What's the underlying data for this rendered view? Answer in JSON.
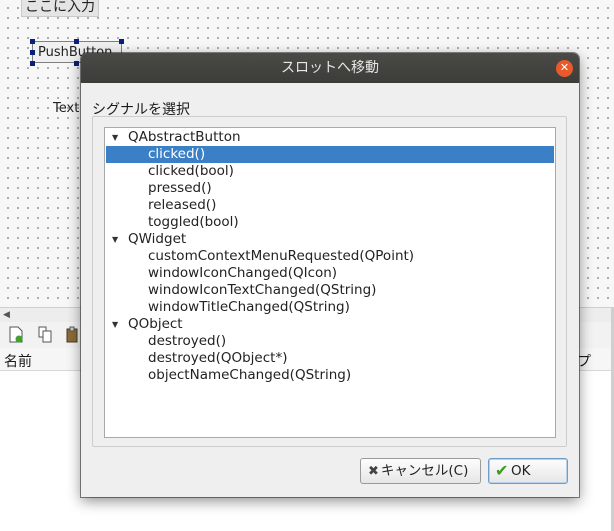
{
  "designer": {
    "menu_entry": "ここに入力",
    "push_button": "PushButton",
    "text_label": "Text",
    "header_name": "名前",
    "header_tail": "プ"
  },
  "dialog": {
    "title": "スロットへ移動",
    "group_title": "シグナルを選択",
    "tree": [
      {
        "label": "QAbstractButton",
        "type": "parent"
      },
      {
        "label": "clicked()",
        "type": "child",
        "selected": true
      },
      {
        "label": "clicked(bool)",
        "type": "child"
      },
      {
        "label": "pressed()",
        "type": "child"
      },
      {
        "label": "released()",
        "type": "child"
      },
      {
        "label": "toggled(bool)",
        "type": "child"
      },
      {
        "label": "QWidget",
        "type": "parent"
      },
      {
        "label": "customContextMenuRequested(QPoint)",
        "type": "child"
      },
      {
        "label": "windowIconChanged(QIcon)",
        "type": "child"
      },
      {
        "label": "windowIconTextChanged(QString)",
        "type": "child"
      },
      {
        "label": "windowTitleChanged(QString)",
        "type": "child"
      },
      {
        "label": "QObject",
        "type": "parent"
      },
      {
        "label": "destroyed()",
        "type": "child"
      },
      {
        "label": "destroyed(QObject*)",
        "type": "child"
      },
      {
        "label": "objectNameChanged(QString)",
        "type": "child"
      }
    ],
    "cancel_label": "キャンセル(C)",
    "ok_label": "OK"
  },
  "colors": {
    "selection": "#3b80c6",
    "titlebar": "#3c3c38",
    "close": "#e85a2a"
  }
}
